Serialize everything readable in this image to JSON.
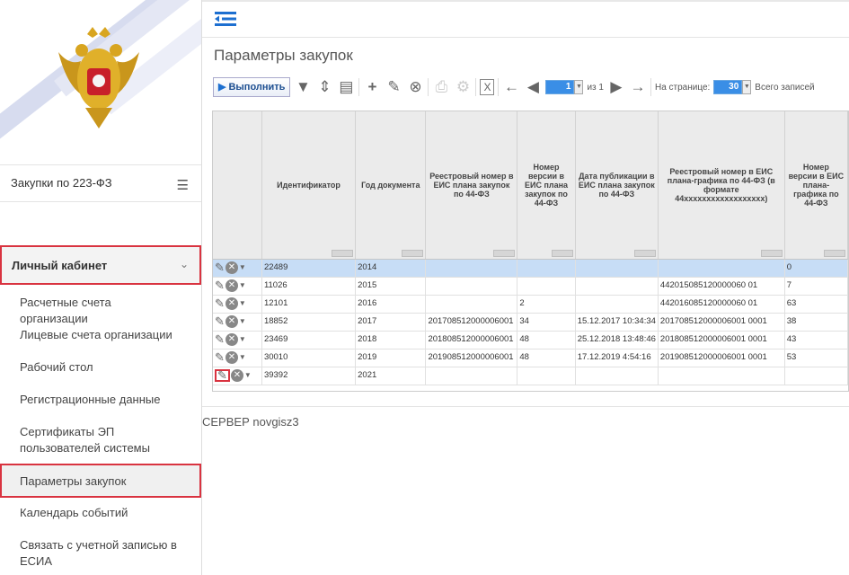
{
  "sidebar": {
    "section_title": "Закупки по 223-ФЗ",
    "cabinet_label": "Личный кабинет",
    "items": [
      {
        "label": "Расчетные счета организации",
        "active": false
      },
      {
        "label": "Лицевые счета организации",
        "active": false
      },
      {
        "label": "Рабочий стол",
        "active": false
      },
      {
        "label": "Регистрационные данные",
        "active": false
      },
      {
        "label": "Сертификаты ЭП пользователей системы",
        "active": false
      },
      {
        "label": "Параметры закупок",
        "active": true
      },
      {
        "label": "Календарь событий",
        "active": false
      },
      {
        "label": "Связать с учетной записью в ЕСИА",
        "active": false
      }
    ]
  },
  "page": {
    "title": "Параметры закупок"
  },
  "toolbar": {
    "run_label": "Выполнить",
    "page_value": "1",
    "page_of": "из 1",
    "per_page_label": "На странице:",
    "per_page_value": "30",
    "total_label": "Всего записей"
  },
  "grid": {
    "columns": [
      "",
      "Идентификатор",
      "Год документа",
      "Реестровый номер в ЕИС плана закупок по 44-ФЗ",
      "Номер версии в ЕИС плана закупок по 44-ФЗ",
      "Дата публикации в ЕИС плана закупок по 44-ФЗ",
      "Реестровый номер в ЕИС плана-графика по 44-ФЗ (в формате 44xxxxxxxxxxxxxxxxxx)",
      "Номер версии в ЕИС плана-графика по 44-ФЗ"
    ],
    "rows": [
      {
        "id": "22489",
        "year": "2014",
        "reg_plan": "",
        "ver_plan": "",
        "pub_date": "",
        "reg_schedule": "",
        "ver_schedule": "0",
        "selected": true
      },
      {
        "id": "11026",
        "year": "2015",
        "reg_plan": "",
        "ver_plan": "",
        "pub_date": "",
        "reg_schedule": "442015085120000060 01",
        "ver_schedule": "7",
        "selected": false
      },
      {
        "id": "12101",
        "year": "2016",
        "reg_plan": "",
        "ver_plan": "2",
        "pub_date": "",
        "reg_schedule": "442016085120000060 01",
        "ver_schedule": "63",
        "selected": false
      },
      {
        "id": "18852",
        "year": "2017",
        "reg_plan": "201708512000006001",
        "ver_plan": "34",
        "pub_date": "15.12.2017 10:34:34",
        "reg_schedule": "201708512000006001 0001",
        "ver_schedule": "38",
        "selected": false
      },
      {
        "id": "23469",
        "year": "2018",
        "reg_plan": "201808512000006001",
        "ver_plan": "48",
        "pub_date": "25.12.2018 13:48:46",
        "reg_schedule": "201808512000006001 0001",
        "ver_schedule": "43",
        "selected": false
      },
      {
        "id": "30010",
        "year": "2019",
        "reg_plan": "201908512000006001",
        "ver_plan": "48",
        "pub_date": "17.12.2019 4:54:16",
        "reg_schedule": "201908512000006001 0001",
        "ver_schedule": "53",
        "selected": false
      },
      {
        "id": "39392",
        "year": "2021",
        "reg_plan": "",
        "ver_plan": "",
        "pub_date": "",
        "reg_schedule": "",
        "ver_schedule": "",
        "selected": false
      }
    ]
  },
  "footer": {
    "server": "СЕРВЕР novgisz3"
  },
  "colors": {
    "accent_red": "#d93340",
    "selected_row": "#c7ddf6",
    "brand_blue": "#1d6fd0"
  },
  "icons": {
    "menu_toggle": "menu-toggle-icon",
    "filter": "filter-icon",
    "sort": "sort-icon",
    "document": "document-icon",
    "add": "plus-icon",
    "edit": "pencil-icon",
    "cancel": "cancel-icon",
    "print": "printer-icon",
    "settings": "gears-icon",
    "excel": "excel-icon",
    "prev": "arrow-left-icon",
    "first": "circle-left-icon",
    "next": "circle-right-icon",
    "last": "arrow-right-icon"
  }
}
